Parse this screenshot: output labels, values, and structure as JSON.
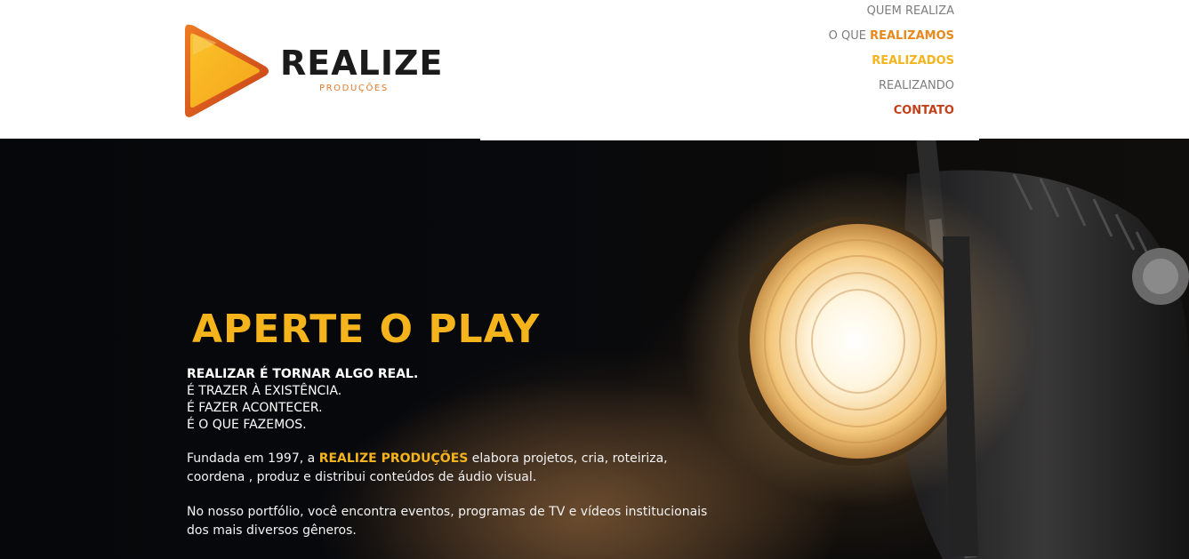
{
  "brand": {
    "name": "REALIZE",
    "tagline": "PRODUÇÕES",
    "colors": {
      "orange": "#e57a2c",
      "yellow": "#f5b41c",
      "red": "#c3401a",
      "dark": "#1b1b1b"
    }
  },
  "nav": {
    "quem_realiza": "QUEM REALIZA",
    "o_que_prefix": "O QUE ",
    "o_que_bold": "REALIZAMOS",
    "realizados": "REALIZADOS",
    "realizando": "REALIZANDO",
    "contato": "CONTATO"
  },
  "hero": {
    "headline": "APERTE O PLAY",
    "lines": [
      "REALIZAR É TORNAR ALGO REAL.",
      "É TRAZER À EXISTÊNCIA.",
      "É FAZER ACONTECER.",
      "É O QUE FAZEMOS."
    ],
    "para1_before": "Fundada em 1997, a ",
    "para1_highlight": "REALIZE PRODUÇÕES",
    "para1_after": " elabora projetos, cria, roteiriza, coordena , produz e distribui conteúdos de áudio visual.",
    "para2": "No nosso portfólio, você encontra eventos, programas de TV e vídeos institucionais dos mais diversos gêneros."
  }
}
